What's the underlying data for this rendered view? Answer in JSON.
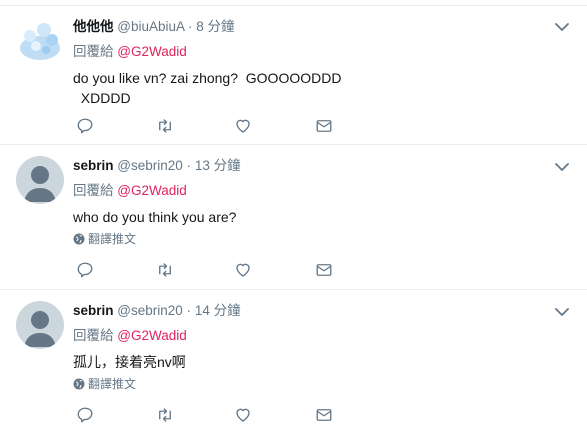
{
  "tweets": [
    {
      "name": "他他他",
      "handle": "@biuAbiuA",
      "separator": "·",
      "time": "8 分鐘",
      "reply_prefix": "回覆給",
      "mention": "@G2Wadid",
      "text": "do you like vn? zai zhong?  GOOOOODDD\n  XDDDD",
      "translate": "",
      "avatar": "cartoon-avatar"
    },
    {
      "name": "sebrin",
      "handle": "@sebrin20",
      "separator": "·",
      "time": "13 分鐘",
      "reply_prefix": "回覆給",
      "mention": "@G2Wadid",
      "text": "who do you think you are?",
      "translate": "翻譯推文",
      "avatar": "default-avatar"
    },
    {
      "name": "sebrin",
      "handle": "@sebrin20",
      "separator": "·",
      "time": "14 分鐘",
      "reply_prefix": "回覆給",
      "mention": "@G2Wadid",
      "text": "孤儿，接着亮nv啊",
      "translate": "翻譯推文",
      "avatar": "default-avatar"
    }
  ],
  "icons": {
    "reply": "reply-icon",
    "retweet": "retweet-icon",
    "like": "heart-icon",
    "dm": "envelope-icon",
    "caret": "chevron-down-icon",
    "globe": "globe-icon"
  },
  "colors": {
    "mention": "#e0245e",
    "secondary": "#657786",
    "border": "#e6ecf0",
    "icon": "#657786"
  }
}
